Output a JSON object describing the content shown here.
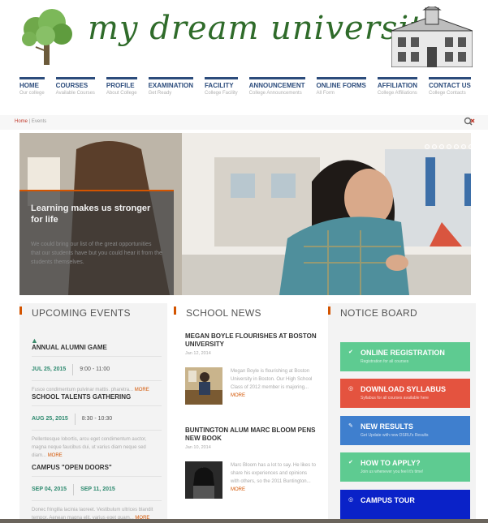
{
  "site": {
    "logo_text": "my dream university"
  },
  "nav": [
    {
      "label": "HOME",
      "sub": "Our college"
    },
    {
      "label": "COURSES",
      "sub": "Available Courses"
    },
    {
      "label": "PROFILE",
      "sub": "About College"
    },
    {
      "label": "EXAMINATION",
      "sub": "Get Ready"
    },
    {
      "label": "FACILITY",
      "sub": "College Facility"
    },
    {
      "label": "ANNOUNCEMENT",
      "sub": "College Announcements"
    },
    {
      "label": "ONLINE FORMS",
      "sub": "All Form"
    },
    {
      "label": "AFFILIATION",
      "sub": "College Affiliations"
    },
    {
      "label": "CONTACT US",
      "sub": "College Contacts"
    }
  ],
  "breadcrumb": {
    "home": "Home",
    "separator": "|",
    "current": "Events"
  },
  "hero": {
    "title": "Learning makes us stronger for life",
    "text": "We could bring our list of the great opportunities that our students have but you could hear it from the students themselves."
  },
  "events": {
    "heading": "UPCOMING EVENTS",
    "items": [
      {
        "title": "ANNUAL ALUMNI GAME",
        "date": "JUL 25, 2015",
        "time": "9:00 - 11:00",
        "desc": "Fusce condimentum pulvinar mattis. pharetra...",
        "more": "MORE"
      },
      {
        "title": "SCHOOL TALENTS GATHERING",
        "date": "AUG 25, 2015",
        "time": "8:30 - 10:30",
        "desc": "Pellentesque lobortis, arcu eget condimentum auctor, magna neque faucibus dui, ut varius diam neque sed diam...",
        "more": "MORE"
      },
      {
        "title": "CAMPUS \"OPEN DOORS\"",
        "date": "SEP 04, 2015",
        "date2": "SEP 11, 2015",
        "desc": "Donec fringilla lacinia laoreet. Vestibulum ultrices blandit tempor. Aenean magna elit, varius eget quam...",
        "more": "MORE"
      }
    ]
  },
  "news": {
    "heading": "SCHOOL NEWS",
    "items": [
      {
        "title": "MEGAN BOYLE FLOURISHES AT BOSTON UNIVERSITY",
        "date": "Jan 12, 2014",
        "text": "Megan Boyle is flourishing at Boston University in Boston. Our High School Class of 2012 member is majoring...",
        "more": "MORE"
      },
      {
        "title": "BUNTINGTON ALUM MARC BLOOM PENS NEW BOOK",
        "date": "Jan 10, 2014",
        "text": "Marc Bloom has a lot to say. He likes to share his experiences and opinions with others, so the 2011 Buntington...",
        "more": "MORE"
      }
    ]
  },
  "notice": {
    "heading": "NOTICE BOARD",
    "items": [
      {
        "label": "ONLINE REGISTRATION",
        "sub": "Registration for all courses",
        "color": "#5ecb91",
        "icon": "check-icon"
      },
      {
        "label": "DOWNLOAD SYLLABUS",
        "sub": "Syllabus for all courses available here",
        "color": "#e4533f",
        "icon": "circle-icon"
      },
      {
        "label": "NEW RESULTS",
        "sub": "Get Update with new DSRU's Results",
        "color": "#3f7fce",
        "icon": "pencil-icon"
      },
      {
        "label": "HOW TO APPLY?",
        "sub": "Join us whenever you feel it's time!",
        "color": "#5ecb91",
        "icon": "check-icon"
      },
      {
        "label": "CAMPUS TOUR",
        "sub": "",
        "color": "#0a22c8",
        "icon": "circle-icon"
      }
    ]
  }
}
